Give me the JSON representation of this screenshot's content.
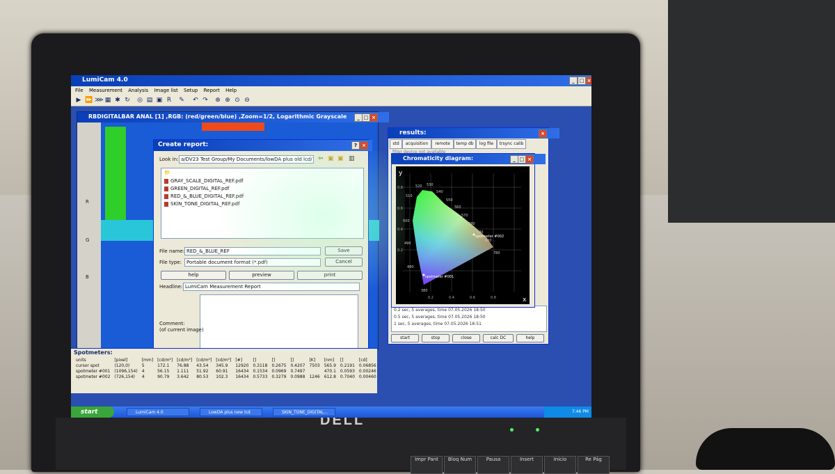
{
  "app": {
    "title": "LumiCam 4.0",
    "menu": [
      "File",
      "Measurement",
      "Analysis",
      "Image list",
      "Setup",
      "Report",
      "Help"
    ]
  },
  "image_window": {
    "title": "RBDIGITALBAR ANAL [1] ,RGB: (red/green/blue) ,Zoom=1/2, Logarithmic Grayscale",
    "axis_labels": [
      "R",
      "G",
      "B"
    ],
    "tag": "#001"
  },
  "dialog": {
    "title": "Create report:",
    "look_in_label": "Look in:",
    "look_in_value": "a/DV23 Test Group/My Documents/lowDA plus old lcd/",
    "files": [
      "GRAY_SCALE_DIGITAL_REF.pdf",
      "GREEN_DIGITAL_REF.pdf",
      "RED_&_BLUE_DIGITAL_REF.pdf",
      "SKIN_TONE_DIGITAL_REF.pdf"
    ],
    "file_name_label": "File name:",
    "file_name_value": "RED_&_BLUE_REF",
    "file_type_label": "File type:",
    "file_type_value": "Portable document format (*.pdf)",
    "save": "Save",
    "cancel": "Cancel",
    "help": "help",
    "preview": "preview",
    "print": "print",
    "headline_label": "Headline:",
    "headline_value": "LumiCam Measurement Report",
    "comment_label": "Comment:",
    "comment_note": "(of current image)"
  },
  "results": {
    "title": "results:",
    "tabs": [
      "std",
      "acquisition",
      "remote",
      "temp db",
      "log file",
      "trsync calib"
    ],
    "filter_note": "filter device not available",
    "messages": [
      "0.2 sec, 5 averages, time 07.05.2026 18:50",
      "0.5 sec, 5 averages, time 07.05.2026 18:50",
      "1 sec, 5 averages, time 07.05.2026 18:51"
    ],
    "buttons": [
      "start",
      "stop",
      "close",
      "calc DC",
      "help"
    ]
  },
  "chroma": {
    "title": "Chromaticity diagram:",
    "y_label": "y",
    "x_label": "x",
    "wavelengths": [
      "520",
      "530",
      "540",
      "510",
      "550",
      "560",
      "570",
      "580",
      "590",
      "600",
      "780",
      "490",
      "480",
      "380",
      "500"
    ],
    "spots": [
      "spotmeter #002",
      "spotmeter #001"
    ],
    "x_ticks": [
      "0.2",
      "0.4",
      "0.6",
      "0.8"
    ],
    "y_ticks": [
      "0.8",
      "0.6",
      "0.4",
      "0.2"
    ]
  },
  "spotmeters": {
    "title": "Spotmeters:",
    "header": [
      "Object",
      "pos",
      "",
      "",
      "",
      "",
      "",
      "",
      "",
      "",
      "",
      "",
      ""
    ],
    "units": [
      "units",
      "[pixel]",
      "[mm]",
      "[cd/m²]",
      "[cd/m²]",
      "[cd/m²]",
      "[cd/m²]",
      "[#]",
      "[]",
      "[]",
      "[]",
      "[K]",
      "[nm]",
      "[]",
      "[cd]"
    ],
    "rows": [
      [
        "cursor spot",
        "(120,0)",
        "5",
        "172.1",
        "76.88",
        "43.54",
        "345.9",
        "12920",
        "0.3118",
        "0.2675",
        "0.4207",
        "7503",
        "565.9",
        "0.2191",
        "0.06856"
      ],
      [
        "spotmeter #001",
        "(1096,154)",
        "4",
        "56.15",
        "1.111",
        "51.92",
        "60.91",
        "16434",
        "0.1534",
        "0.0969",
        "0.7497",
        "",
        "470.1",
        "0.0593",
        "0.00246"
      ],
      [
        "spotmeter #002",
        "(726,154)",
        "4",
        "90.79",
        "3.642",
        "80.53",
        "102.3",
        "16434",
        "0.5733",
        "0.3279",
        "0.0988",
        "1246",
        "612.8",
        "0.7040",
        "0.00460"
      ]
    ]
  },
  "taskbar": {
    "start": "start",
    "tasks": [
      "LumiCam 4.0",
      "LowDA plus new lcd",
      "SKIN_TONE_DIGITAL..."
    ],
    "clock": "7:46 PM"
  },
  "hardware": {
    "brand": "DELL",
    "keys": [
      "Impr Pant",
      "Bloq Num",
      "Pausa",
      "Insert",
      "Inicio",
      "Re Pág"
    ]
  }
}
